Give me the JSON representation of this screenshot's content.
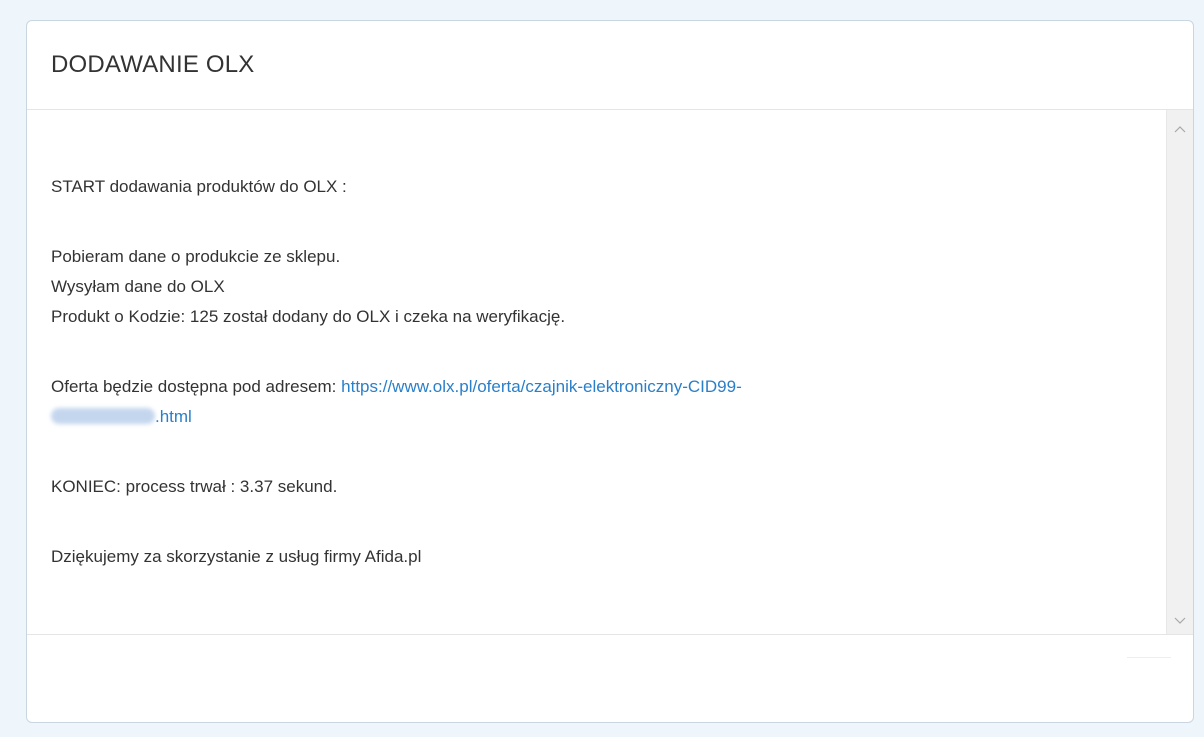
{
  "modal": {
    "title": "DODAWANIE OLX"
  },
  "log": {
    "start": "START dodawania produktów do OLX :",
    "fetching": "Pobieram dane o produkcie ze sklepu.",
    "sending": "Wysyłam dane do OLX",
    "product_added": "Produkt o Kodzie: 125 został dodany do OLX i czeka na weryfikację.",
    "offer_prefix": "Oferta będzie dostępna pod adresem: ",
    "offer_link_part1": "https://www.olx.pl/oferta/czajnik-elektroniczny-CID99-",
    "offer_link_part2": ".html",
    "end": "KONIEC: process trwał : 3.37 sekund.",
    "thanks": "Dziękujemy za skorzystanie z usług firmy Afida.pl"
  },
  "scrollbar": {
    "up_icon": "chevron-up-icon",
    "down_icon": "chevron-down-icon"
  },
  "colors": {
    "link": "#2a7fc9",
    "background": "#eef5fb"
  }
}
